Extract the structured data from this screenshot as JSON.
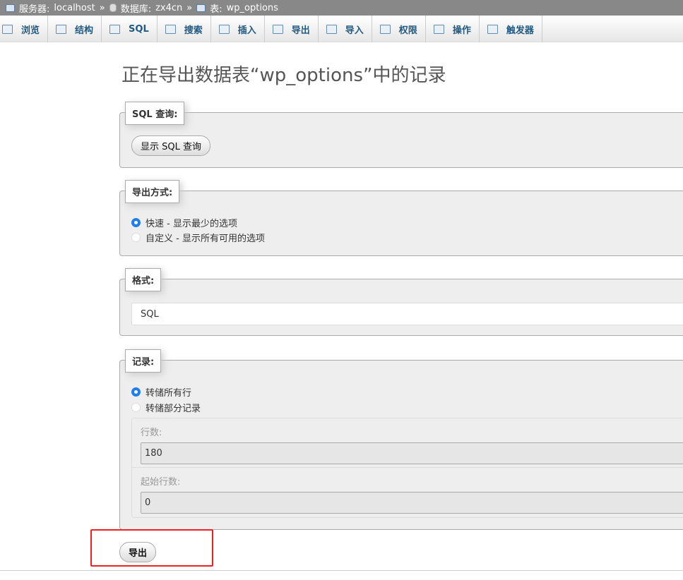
{
  "breadcrumb": {
    "server_label": "服务器:",
    "server": "localhost",
    "db_label": "数据库:",
    "db": "zx4cn",
    "table_label": "表:",
    "table": "wp_options",
    "separator": "»"
  },
  "tabs": [
    {
      "label": "浏览",
      "icon": "browse-icon"
    },
    {
      "label": "结构",
      "icon": "structure-icon"
    },
    {
      "label": "SQL",
      "icon": "sql-icon"
    },
    {
      "label": "搜索",
      "icon": "search-icon"
    },
    {
      "label": "插入",
      "icon": "insert-icon"
    },
    {
      "label": "导出",
      "icon": "export-icon"
    },
    {
      "label": "导入",
      "icon": "import-icon"
    },
    {
      "label": "权限",
      "icon": "privileges-icon"
    },
    {
      "label": "操作",
      "icon": "wrench-icon"
    },
    {
      "label": "触发器",
      "icon": "triggers-icon"
    }
  ],
  "title": "正在导出数据表“wp_options”中的记录",
  "sql_query": {
    "legend": "SQL 查询:",
    "button": "显示 SQL 查询"
  },
  "export_method": {
    "legend": "导出方式:",
    "options": [
      {
        "label": "快速 - 显示最少的选项",
        "selected": true
      },
      {
        "label": "自定义 - 显示所有可用的选项",
        "selected": false
      }
    ]
  },
  "format": {
    "legend": "格式:",
    "value": "SQL"
  },
  "rows": {
    "legend": "记录:",
    "options": [
      {
        "label": "转储所有行",
        "selected": true
      },
      {
        "label": "转储部分记录",
        "selected": false
      }
    ],
    "row_count_label": "行数:",
    "row_count": "180",
    "start_row_label": "起始行数:",
    "start_row": "0"
  },
  "export_button": "导出",
  "colors": {
    "accent": "#1e7ef0",
    "highlight": "#f02020",
    "tab_text": "#235a81"
  }
}
